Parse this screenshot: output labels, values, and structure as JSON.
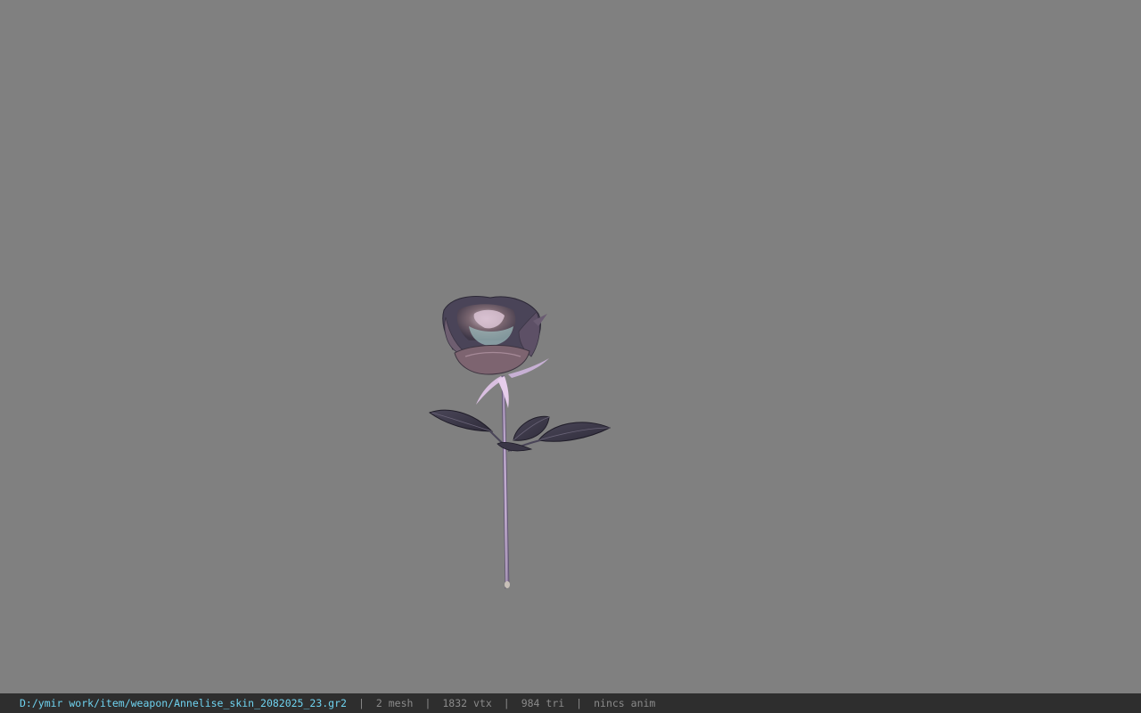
{
  "viewer": {
    "background_color": "#808080",
    "model_name": "rose-model"
  },
  "status_bar": {
    "file_path": "D:/ymir work/item/weapon/Annelise_skin_2082025_23.gr2",
    "separator": "|",
    "mesh": "2 mesh",
    "vertices": "1832 vtx",
    "triangles": "984 tri",
    "anim": "nincs anim",
    "path_color": "#6fd3f0",
    "text_color": "#8a8a8a"
  }
}
